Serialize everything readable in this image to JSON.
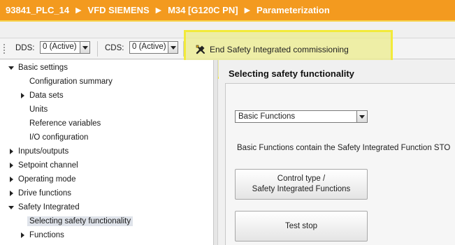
{
  "breadcrumb": [
    "93841_PLC_14",
    "VFD SIEMENS",
    "M34 [G120C PN]",
    "Parameterization"
  ],
  "toolbar": {
    "dds_label": "DDS:",
    "dds_value": "0 (Active)",
    "cds_label": "CDS:",
    "cds_value": "0 (Active)",
    "end_commissioning_label": "End Safety Integrated commissioning",
    "end_commissioning_icon": "tools-icon"
  },
  "tree": {
    "items": [
      {
        "label": "Basic settings",
        "level": 0,
        "state": "open"
      },
      {
        "label": "Configuration summary",
        "level": 1,
        "state": "leaf"
      },
      {
        "label": "Data sets",
        "level": 1,
        "state": "closed"
      },
      {
        "label": "Units",
        "level": 1,
        "state": "leaf"
      },
      {
        "label": "Reference variables",
        "level": 1,
        "state": "leaf"
      },
      {
        "label": "I/O configuration",
        "level": 1,
        "state": "leaf"
      },
      {
        "label": "Inputs/outputs",
        "level": 0,
        "state": "closed"
      },
      {
        "label": "Setpoint channel",
        "level": 0,
        "state": "closed"
      },
      {
        "label": "Operating mode",
        "level": 0,
        "state": "closed"
      },
      {
        "label": "Drive functions",
        "level": 0,
        "state": "closed"
      },
      {
        "label": "Safety Integrated",
        "level": 0,
        "state": "open"
      },
      {
        "label": "Selecting safety functionality",
        "level": 1,
        "state": "leaf",
        "selected": true
      },
      {
        "label": "Functions",
        "level": 1,
        "state": "closed"
      }
    ]
  },
  "main": {
    "section_title": "Selecting safety functionality",
    "function_select_value": "Basic Functions",
    "description": "Basic Functions contain the Safety Integrated Function STO",
    "buttons": [
      {
        "line1": "Control type /",
        "line2": "Safety Integrated Functions"
      },
      {
        "line1": "Test stop",
        "line2": ""
      }
    ]
  },
  "colors": {
    "title_bar": "#f39a1f",
    "highlight": "#f2ea3a",
    "selected_row": "#dfe3ea"
  }
}
